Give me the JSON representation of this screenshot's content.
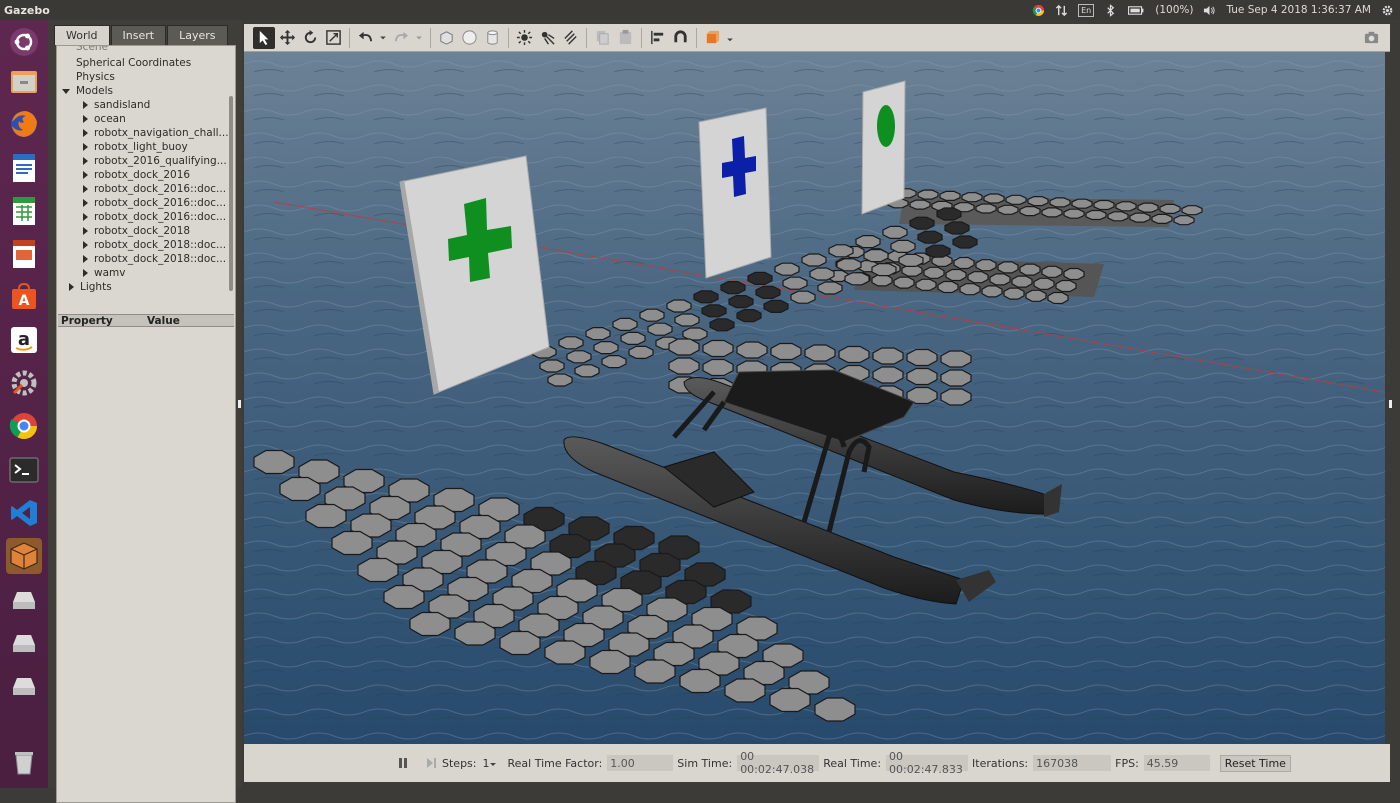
{
  "topbar": {
    "app_title": "Gazebo",
    "keyboard": "En",
    "battery": "(100%)",
    "datetime": "Tue Sep  4 2018  1:36:37 AM"
  },
  "left_panel": {
    "tabs": [
      {
        "label": "World",
        "active": true
      },
      {
        "label": "Insert",
        "active": false
      },
      {
        "label": "Layers",
        "active": false
      }
    ],
    "tree": {
      "scene": "Scene",
      "spherical": "Spherical Coordinates",
      "physics": "Physics",
      "models_label": "Models",
      "models": [
        "sandisland",
        "ocean",
        "robotx_navigation_chall...",
        "robotx_light_buoy",
        "robotx_2016_qualifying...",
        "robotx_dock_2016",
        "robotx_dock_2016::doc...",
        "robotx_dock_2016::doc...",
        "robotx_dock_2016::doc...",
        "robotx_dock_2018",
        "robotx_dock_2018::doc...",
        "robotx_dock_2018::doc...",
        "wamv"
      ],
      "lights": "Lights"
    },
    "properties": {
      "col_property": "Property",
      "col_value": "Value"
    }
  },
  "bottombar": {
    "steps_label": "Steps:",
    "steps_value": "1",
    "rtf_label": "Real Time Factor:",
    "rtf_value": "1.00",
    "sim_time_label": "Sim Time:",
    "sim_time_value": "00 00:02:47.038",
    "real_time_label": "Real Time:",
    "real_time_value": "00 00:02:47.833",
    "iterations_label": "Iterations:",
    "iterations_value": "167038",
    "fps_label": "FPS:",
    "fps_value": "45.59",
    "reset_label": "Reset Time"
  },
  "colors": {
    "accent": "#e95420",
    "launcher": "#5e2750",
    "water": "#3c5a78",
    "green_mark": "#0f8f1f",
    "blue_mark": "#0b1fa8"
  }
}
